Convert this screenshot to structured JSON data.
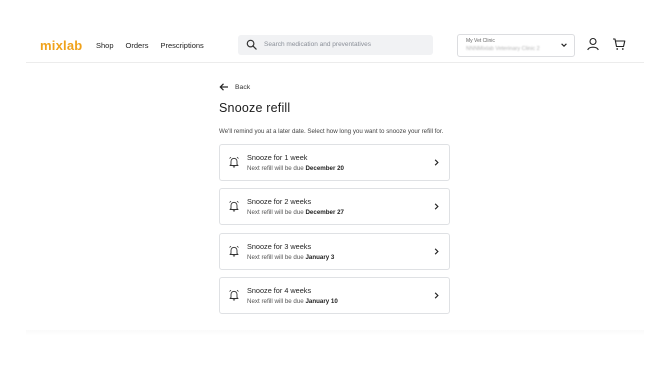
{
  "brand": {
    "logo": "mixlab",
    "accent": "#f0a21b"
  },
  "nav": {
    "shop": "Shop",
    "orders": "Orders",
    "prescriptions": "Prescriptions"
  },
  "search": {
    "placeholder": "Search medication and preventatives"
  },
  "clinic": {
    "label": "My Vet Clinic",
    "value": "NNNMixlab Veterinary Clinic 2"
  },
  "page": {
    "back": "Back",
    "title": "Snooze refill",
    "description": "We'll remind you at a later date. Select how long you want to snooze your refill for.",
    "options": [
      {
        "title": "Snooze for 1 week",
        "sub_prefix": "Next refill will be due ",
        "date": "December 20"
      },
      {
        "title": "Snooze for 2 weeks",
        "sub_prefix": "Next refill will be due ",
        "date": "December 27"
      },
      {
        "title": "Snooze for 3 weeks",
        "sub_prefix": "Next refill will be due ",
        "date": "January 3"
      },
      {
        "title": "Snooze for 4 weeks",
        "sub_prefix": "Next refill will be due ",
        "date": "January 10"
      }
    ]
  }
}
